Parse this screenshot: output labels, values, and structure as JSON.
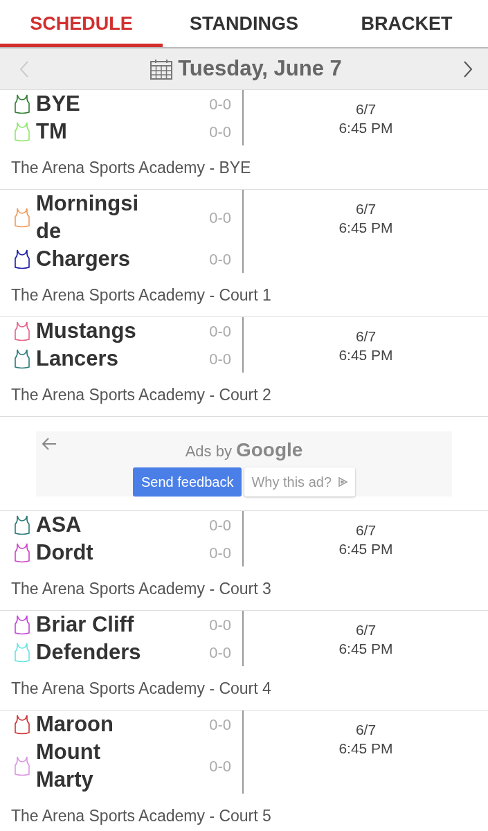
{
  "tabs": [
    {
      "label": "SCHEDULE",
      "selected": true
    },
    {
      "label": "STANDINGS",
      "selected": false
    },
    {
      "label": "BRACKET",
      "selected": false
    }
  ],
  "date_bar": {
    "title": "Tuesday, June 7"
  },
  "games": [
    {
      "teams": [
        {
          "name": "BYE",
          "record": "0-0",
          "color": "#2e7d32"
        },
        {
          "name": "TM",
          "record": "0-0",
          "color": "#8ee66a"
        }
      ],
      "date": "6/7",
      "time": "6:45 PM",
      "venue": "The Arena Sports Academy - BYE"
    },
    {
      "teams": [
        {
          "name": "Morningside",
          "record": "0-0",
          "color": "#f09a5a"
        },
        {
          "name": "Chargers",
          "record": "0-0",
          "color": "#1a1aa8"
        }
      ],
      "date": "6/7",
      "time": "6:45 PM",
      "venue": "The Arena Sports Academy - Court 1"
    },
    {
      "teams": [
        {
          "name": "Mustangs",
          "record": "0-0",
          "color": "#e8608a"
        },
        {
          "name": "Lancers",
          "record": "0-0",
          "color": "#2a7a78"
        }
      ],
      "date": "6/7",
      "time": "6:45 PM",
      "venue": "The Arena Sports Academy - Court 2"
    },
    {
      "kind": "ad",
      "ads_by": "Ads by",
      "brand": "Google",
      "buttons": [
        "Send feedback",
        "Why this ad?"
      ]
    },
    {
      "teams": [
        {
          "name": "ASA",
          "record": "0-0",
          "color": "#2a7a78"
        },
        {
          "name": "Dordt",
          "record": "0-0",
          "color": "#cc44cc"
        }
      ],
      "date": "6/7",
      "time": "6:45 PM",
      "venue": "The Arena Sports Academy - Court 3"
    },
    {
      "teams": [
        {
          "name": "Briar Cliff",
          "record": "0-0",
          "color": "#c444dc"
        },
        {
          "name": "Defenders",
          "record": "0-0",
          "color": "#66e4e4"
        }
      ],
      "date": "6/7",
      "time": "6:45 PM",
      "venue": "The Arena Sports Academy - Court 4"
    },
    {
      "teams": [
        {
          "name": "Maroon",
          "record": "0-0",
          "color": "#cc3333"
        },
        {
          "name": "Mount Marty",
          "record": "0-0",
          "color": "#dc96e2"
        }
      ],
      "date": "6/7",
      "time": "6:45 PM",
      "venue": "The Arena Sports Academy - Court 5"
    }
  ]
}
